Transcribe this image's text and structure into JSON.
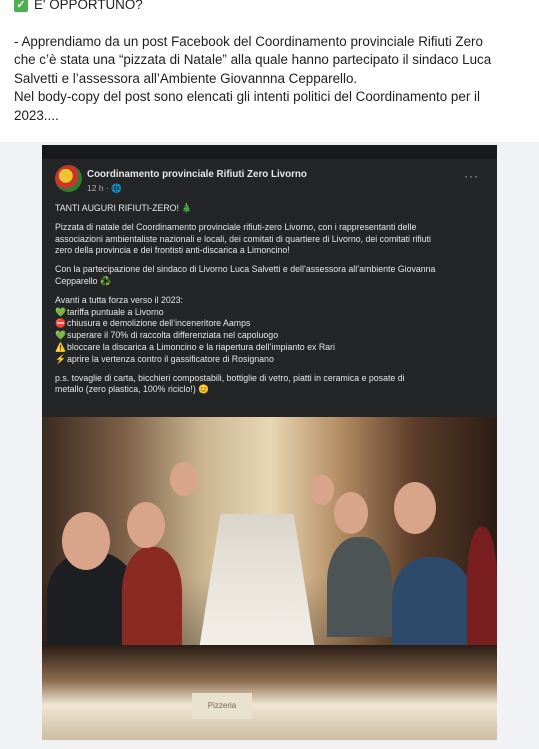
{
  "intro": {
    "heading": "E' OPPORTUNO?",
    "lines": [
      "- Apprendiamo da un post Facebook del Coordinamento provinciale Rifiuti Zero",
      "che c’è stata una “pizzata di Natale” alla quale hanno partecipato il sindaco Luca",
      "Salvetti e l’assessora all’Ambiente Giovannna Cepparello.",
      "Nel body-copy del post sono elencati gli intenti politici del Coordinamento per il",
      "2023...."
    ]
  },
  "post": {
    "author": "Coordinamento provinciale Rifiuti Zero Livorno",
    "time": "12 h · ",
    "more": "···",
    "greeting": "TANTI AUGURI RIFIUTI-ZERO! 🎄",
    "paragraph1": [
      "Pizzata di natale del Coordinamento provinciale rifiuti-zero Livorno, con i rappresentanti delle",
      "associazioni ambientaliste nazionali e locali, dei comitati di quartiere di Livorno, dei comitati rifiuti",
      "zero della provincia e dei frontisti anti-discarica a Limoncino!"
    ],
    "paragraph2": [
      "Con la partecipazione del sindaco di Livorno Luca Salvetti e dell’assessora all’ambiente Giovanna",
      "Cepparello ♻️"
    ],
    "goals_title": "Avanti a tutta forza verso il 2023:",
    "goals": [
      {
        "icon": "💚",
        "text": "tariffa puntuale a Livorno"
      },
      {
        "icon": "⛔",
        "text": "chiusura e demolizione dell’inceneritore Aamps"
      },
      {
        "icon": "💚",
        "text": "superare il 70% di raccolta differenziata nel capoluogo"
      },
      {
        "icon": "⚠️",
        "text": "bloccare la discarica a Limoncino e la riapertura dell’impianto ex Rari"
      },
      {
        "icon": "⚡",
        "text": "aprire la vertenza contro il gassificatore di Rosignano"
      }
    ],
    "ps": [
      "p.s. tovaglie di carta, bicchieri compostabili, bottiglie di vetro, piatti in ceramica e posate di",
      "metallo (zero plastica, 100% riciclo!) 😊"
    ],
    "photo2_sign": "Pizzeria"
  }
}
